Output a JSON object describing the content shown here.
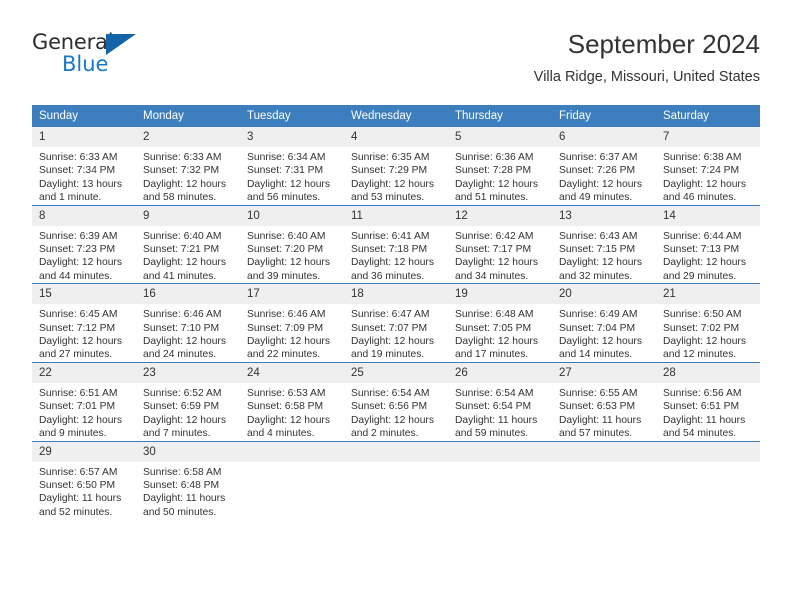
{
  "logo": {
    "primary_text": "General",
    "secondary_text": "Blue",
    "triangle_icon": "blue-triangle-icon",
    "accent_color": "#1878c8"
  },
  "header": {
    "title": "September 2024",
    "subtitle": "Villa Ridge, Missouri, United States"
  },
  "theme": {
    "header_blue": "#3d7ebe",
    "daynum_gray": "#efefef",
    "text": "#333333"
  },
  "calendar": {
    "weekday_headers": [
      "Sunday",
      "Monday",
      "Tuesday",
      "Wednesday",
      "Thursday",
      "Friday",
      "Saturday"
    ],
    "weeks": [
      [
        {
          "day": "1",
          "sunrise": "Sunrise: 6:33 AM",
          "sunset": "Sunset: 7:34 PM",
          "daylight_line1": "Daylight: 13 hours",
          "daylight_line2": "and 1 minute."
        },
        {
          "day": "2",
          "sunrise": "Sunrise: 6:33 AM",
          "sunset": "Sunset: 7:32 PM",
          "daylight_line1": "Daylight: 12 hours",
          "daylight_line2": "and 58 minutes."
        },
        {
          "day": "3",
          "sunrise": "Sunrise: 6:34 AM",
          "sunset": "Sunset: 7:31 PM",
          "daylight_line1": "Daylight: 12 hours",
          "daylight_line2": "and 56 minutes."
        },
        {
          "day": "4",
          "sunrise": "Sunrise: 6:35 AM",
          "sunset": "Sunset: 7:29 PM",
          "daylight_line1": "Daylight: 12 hours",
          "daylight_line2": "and 53 minutes."
        },
        {
          "day": "5",
          "sunrise": "Sunrise: 6:36 AM",
          "sunset": "Sunset: 7:28 PM",
          "daylight_line1": "Daylight: 12 hours",
          "daylight_line2": "and 51 minutes."
        },
        {
          "day": "6",
          "sunrise": "Sunrise: 6:37 AM",
          "sunset": "Sunset: 7:26 PM",
          "daylight_line1": "Daylight: 12 hours",
          "daylight_line2": "and 49 minutes."
        },
        {
          "day": "7",
          "sunrise": "Sunrise: 6:38 AM",
          "sunset": "Sunset: 7:24 PM",
          "daylight_line1": "Daylight: 12 hours",
          "daylight_line2": "and 46 minutes."
        }
      ],
      [
        {
          "day": "8",
          "sunrise": "Sunrise: 6:39 AM",
          "sunset": "Sunset: 7:23 PM",
          "daylight_line1": "Daylight: 12 hours",
          "daylight_line2": "and 44 minutes."
        },
        {
          "day": "9",
          "sunrise": "Sunrise: 6:40 AM",
          "sunset": "Sunset: 7:21 PM",
          "daylight_line1": "Daylight: 12 hours",
          "daylight_line2": "and 41 minutes."
        },
        {
          "day": "10",
          "sunrise": "Sunrise: 6:40 AM",
          "sunset": "Sunset: 7:20 PM",
          "daylight_line1": "Daylight: 12 hours",
          "daylight_line2": "and 39 minutes."
        },
        {
          "day": "11",
          "sunrise": "Sunrise: 6:41 AM",
          "sunset": "Sunset: 7:18 PM",
          "daylight_line1": "Daylight: 12 hours",
          "daylight_line2": "and 36 minutes."
        },
        {
          "day": "12",
          "sunrise": "Sunrise: 6:42 AM",
          "sunset": "Sunset: 7:17 PM",
          "daylight_line1": "Daylight: 12 hours",
          "daylight_line2": "and 34 minutes."
        },
        {
          "day": "13",
          "sunrise": "Sunrise: 6:43 AM",
          "sunset": "Sunset: 7:15 PM",
          "daylight_line1": "Daylight: 12 hours",
          "daylight_line2": "and 32 minutes."
        },
        {
          "day": "14",
          "sunrise": "Sunrise: 6:44 AM",
          "sunset": "Sunset: 7:13 PM",
          "daylight_line1": "Daylight: 12 hours",
          "daylight_line2": "and 29 minutes."
        }
      ],
      [
        {
          "day": "15",
          "sunrise": "Sunrise: 6:45 AM",
          "sunset": "Sunset: 7:12 PM",
          "daylight_line1": "Daylight: 12 hours",
          "daylight_line2": "and 27 minutes."
        },
        {
          "day": "16",
          "sunrise": "Sunrise: 6:46 AM",
          "sunset": "Sunset: 7:10 PM",
          "daylight_line1": "Daylight: 12 hours",
          "daylight_line2": "and 24 minutes."
        },
        {
          "day": "17",
          "sunrise": "Sunrise: 6:46 AM",
          "sunset": "Sunset: 7:09 PM",
          "daylight_line1": "Daylight: 12 hours",
          "daylight_line2": "and 22 minutes."
        },
        {
          "day": "18",
          "sunrise": "Sunrise: 6:47 AM",
          "sunset": "Sunset: 7:07 PM",
          "daylight_line1": "Daylight: 12 hours",
          "daylight_line2": "and 19 minutes."
        },
        {
          "day": "19",
          "sunrise": "Sunrise: 6:48 AM",
          "sunset": "Sunset: 7:05 PM",
          "daylight_line1": "Daylight: 12 hours",
          "daylight_line2": "and 17 minutes."
        },
        {
          "day": "20",
          "sunrise": "Sunrise: 6:49 AM",
          "sunset": "Sunset: 7:04 PM",
          "daylight_line1": "Daylight: 12 hours",
          "daylight_line2": "and 14 minutes."
        },
        {
          "day": "21",
          "sunrise": "Sunrise: 6:50 AM",
          "sunset": "Sunset: 7:02 PM",
          "daylight_line1": "Daylight: 12 hours",
          "daylight_line2": "and 12 minutes."
        }
      ],
      [
        {
          "day": "22",
          "sunrise": "Sunrise: 6:51 AM",
          "sunset": "Sunset: 7:01 PM",
          "daylight_line1": "Daylight: 12 hours",
          "daylight_line2": "and 9 minutes."
        },
        {
          "day": "23",
          "sunrise": "Sunrise: 6:52 AM",
          "sunset": "Sunset: 6:59 PM",
          "daylight_line1": "Daylight: 12 hours",
          "daylight_line2": "and 7 minutes."
        },
        {
          "day": "24",
          "sunrise": "Sunrise: 6:53 AM",
          "sunset": "Sunset: 6:58 PM",
          "daylight_line1": "Daylight: 12 hours",
          "daylight_line2": "and 4 minutes."
        },
        {
          "day": "25",
          "sunrise": "Sunrise: 6:54 AM",
          "sunset": "Sunset: 6:56 PM",
          "daylight_line1": "Daylight: 12 hours",
          "daylight_line2": "and 2 minutes."
        },
        {
          "day": "26",
          "sunrise": "Sunrise: 6:54 AM",
          "sunset": "Sunset: 6:54 PM",
          "daylight_line1": "Daylight: 11 hours",
          "daylight_line2": "and 59 minutes."
        },
        {
          "day": "27",
          "sunrise": "Sunrise: 6:55 AM",
          "sunset": "Sunset: 6:53 PM",
          "daylight_line1": "Daylight: 11 hours",
          "daylight_line2": "and 57 minutes."
        },
        {
          "day": "28",
          "sunrise": "Sunrise: 6:56 AM",
          "sunset": "Sunset: 6:51 PM",
          "daylight_line1": "Daylight: 11 hours",
          "daylight_line2": "and 54 minutes."
        }
      ],
      [
        {
          "day": "29",
          "sunrise": "Sunrise: 6:57 AM",
          "sunset": "Sunset: 6:50 PM",
          "daylight_line1": "Daylight: 11 hours",
          "daylight_line2": "and 52 minutes."
        },
        {
          "day": "30",
          "sunrise": "Sunrise: 6:58 AM",
          "sunset": "Sunset: 6:48 PM",
          "daylight_line1": "Daylight: 11 hours",
          "daylight_line2": "and 50 minutes."
        },
        {
          "day": "",
          "sunrise": "",
          "sunset": "",
          "daylight_line1": "",
          "daylight_line2": ""
        },
        {
          "day": "",
          "sunrise": "",
          "sunset": "",
          "daylight_line1": "",
          "daylight_line2": ""
        },
        {
          "day": "",
          "sunrise": "",
          "sunset": "",
          "daylight_line1": "",
          "daylight_line2": ""
        },
        {
          "day": "",
          "sunrise": "",
          "sunset": "",
          "daylight_line1": "",
          "daylight_line2": ""
        },
        {
          "day": "",
          "sunrise": "",
          "sunset": "",
          "daylight_line1": "",
          "daylight_line2": ""
        }
      ]
    ]
  }
}
